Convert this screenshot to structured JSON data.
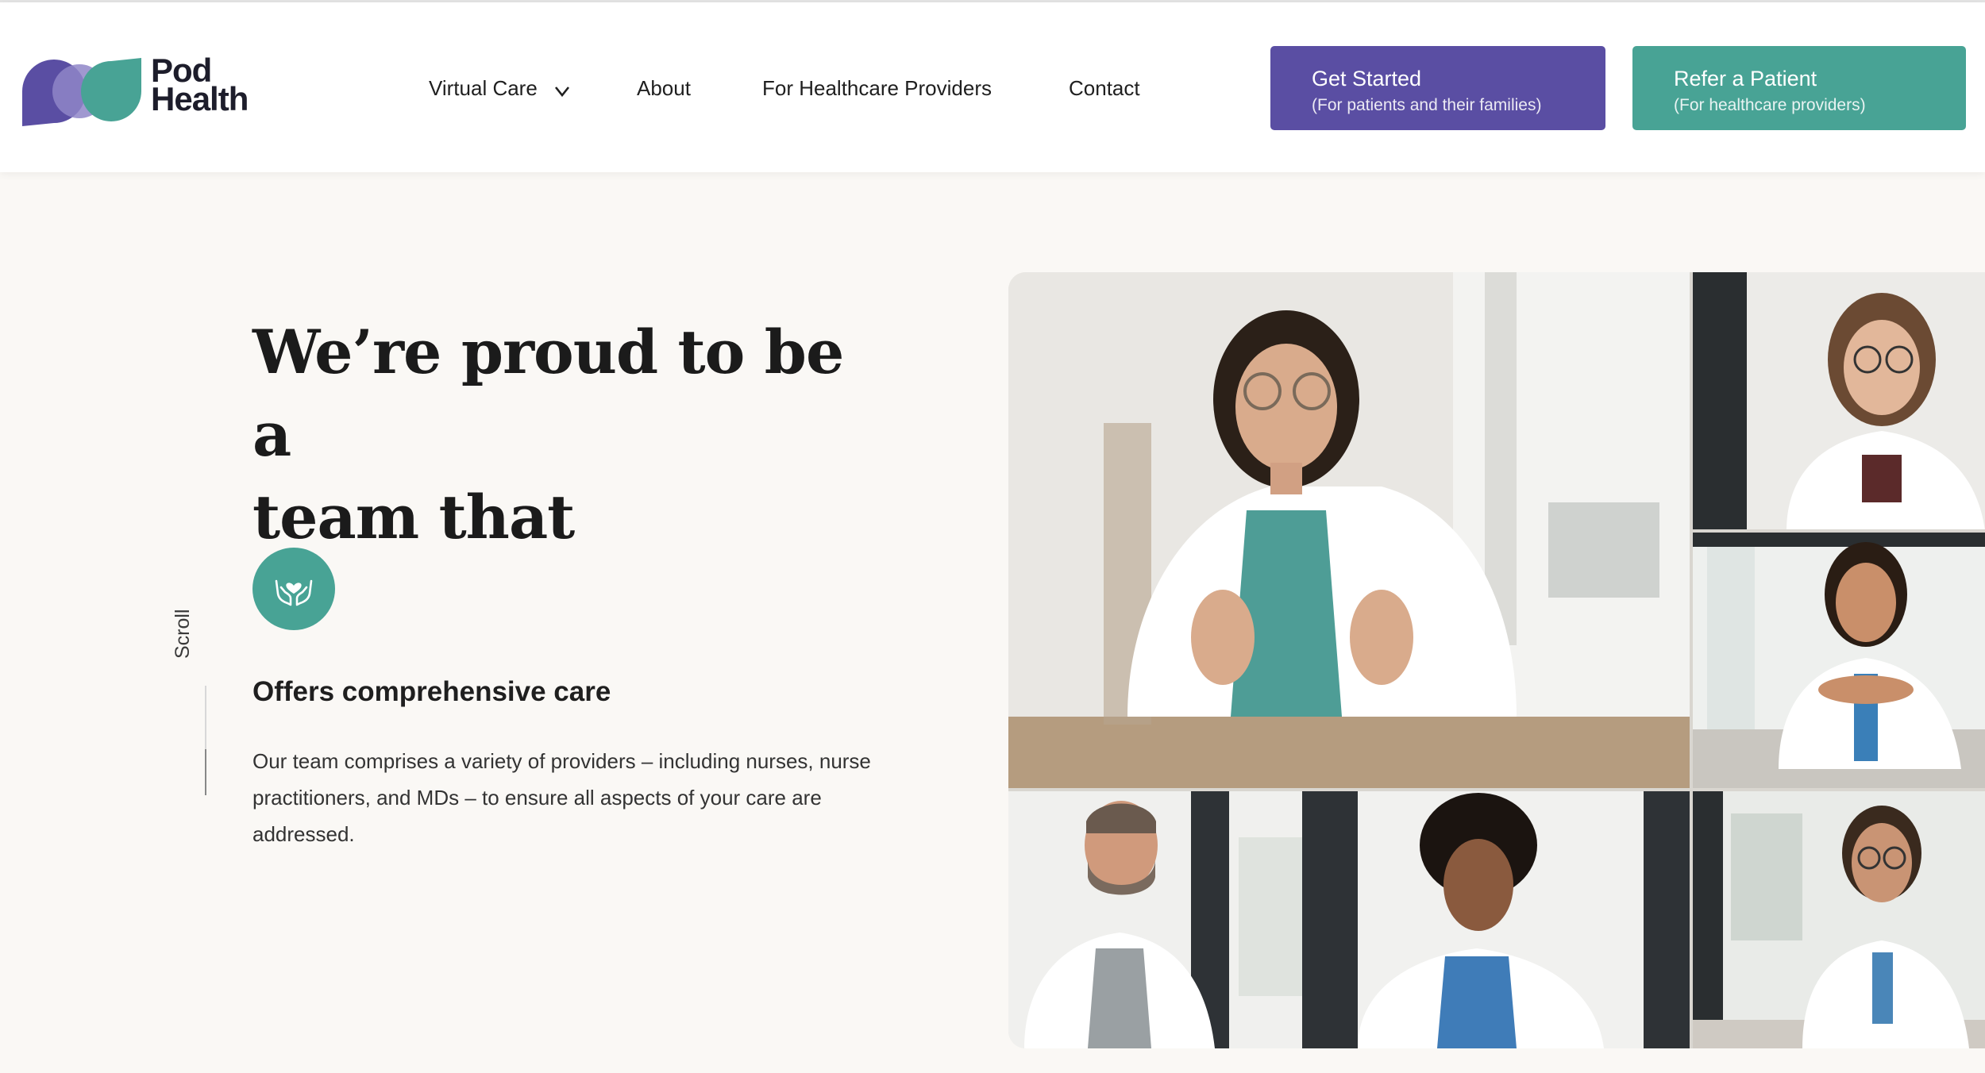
{
  "brand": {
    "logo_line1": "Pod",
    "logo_line2": "Health",
    "colors": {
      "purple": "#5a4ea3",
      "teal": "#48a395",
      "lavender": "#8f86c8"
    }
  },
  "nav": {
    "items": [
      {
        "label": "Virtual Care",
        "has_dropdown": true
      },
      {
        "label": "About"
      },
      {
        "label": "For Healthcare Providers"
      },
      {
        "label": "Contact"
      }
    ]
  },
  "cta": {
    "get_started": {
      "title": "Get Started",
      "subtitle": "(For patients and their families)"
    },
    "refer_patient": {
      "title": "Refer a Patient",
      "subtitle": "(For healthcare providers)"
    }
  },
  "hero": {
    "heading_line1": "We’re proud to be a",
    "heading_line2": "team that",
    "feature_icon": "hands-heart-icon",
    "feature_title": "Offers comprehensive care",
    "feature_body": "Our team comprises a variety of providers – including nurses, nurse practitioners, and MDs – to ensure all aspects of your care are addressed."
  },
  "scroll": {
    "label": "Scroll",
    "progress": 0.42
  },
  "photos": [
    {
      "name": "photo-doctor-main"
    },
    {
      "name": "photo-doctor-top-right"
    },
    {
      "name": "photo-doctor-middle-right"
    },
    {
      "name": "photo-doctor-bottom-left"
    },
    {
      "name": "photo-doctor-bottom-middle"
    },
    {
      "name": "photo-doctor-bottom-right"
    }
  ]
}
